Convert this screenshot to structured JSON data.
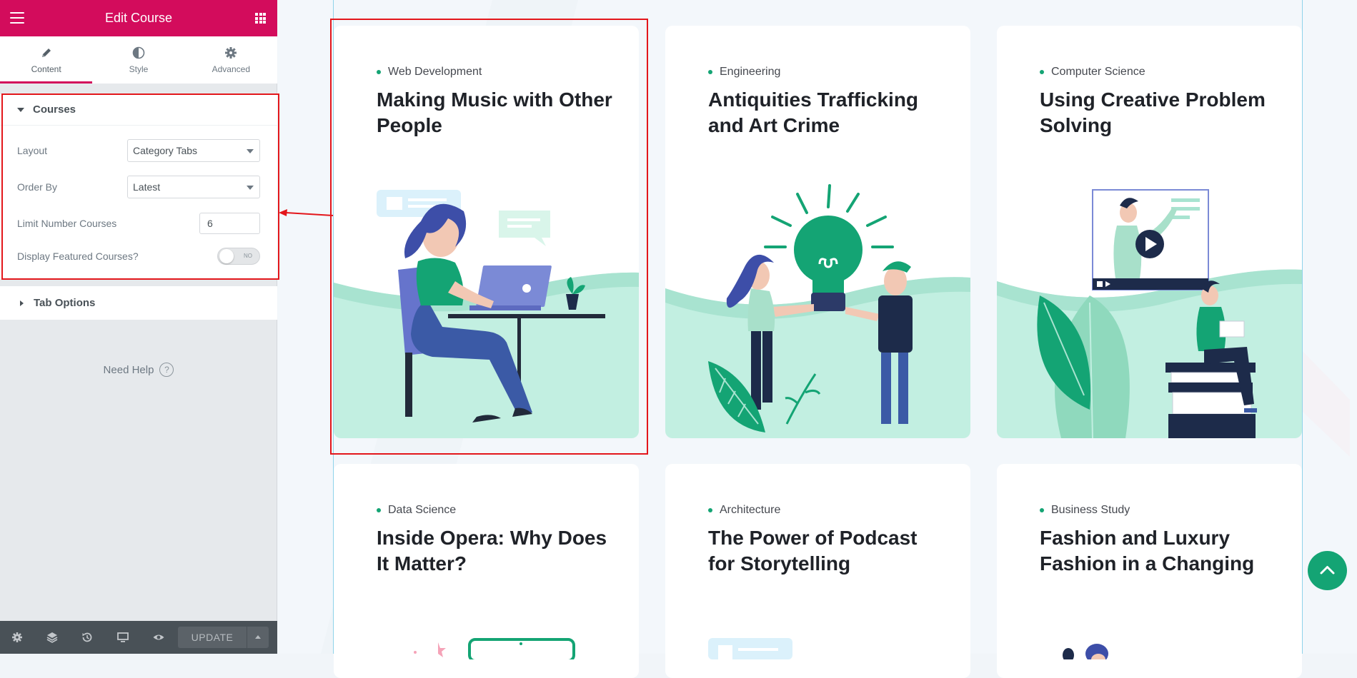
{
  "editor": {
    "title": "Edit Course",
    "tabs": [
      {
        "label": "Content",
        "icon": "pencil-icon",
        "active": true
      },
      {
        "label": "Style",
        "icon": "half-circle-icon",
        "active": false
      },
      {
        "label": "Advanced",
        "icon": "gear-icon",
        "active": false
      }
    ],
    "courses_section": {
      "title": "Courses",
      "layout_label": "Layout",
      "layout_value": "Category Tabs",
      "order_label": "Order By",
      "order_value": "Latest",
      "limit_label": "Limit Number Courses",
      "limit_value": "6",
      "featured_label": "Display Featured Courses?",
      "featured_toggle": "NO"
    },
    "tab_options_title": "Tab Options",
    "help_label": "Need Help",
    "update_label": "UPDATE"
  },
  "courses": [
    {
      "category": "Web Development",
      "title": "Making Music with Other People"
    },
    {
      "category": "Engineering",
      "title": "Antiquities Trafficking and Art Crime"
    },
    {
      "category": "Computer Science",
      "title": "Using Creative Problem Solving"
    },
    {
      "category": "Data Science",
      "title": "Inside Opera: Why Does It Matter?"
    },
    {
      "category": "Architecture",
      "title": "The Power of Podcast for Storytelling"
    },
    {
      "category": "Business Study",
      "title": "Fashion and Luxury Fashion in a Changing"
    }
  ],
  "colors": {
    "brand": "#d30c5c",
    "accent_green": "#14a474",
    "illustration_mint": "#c2efe1",
    "annotation_red": "#e3161b"
  }
}
